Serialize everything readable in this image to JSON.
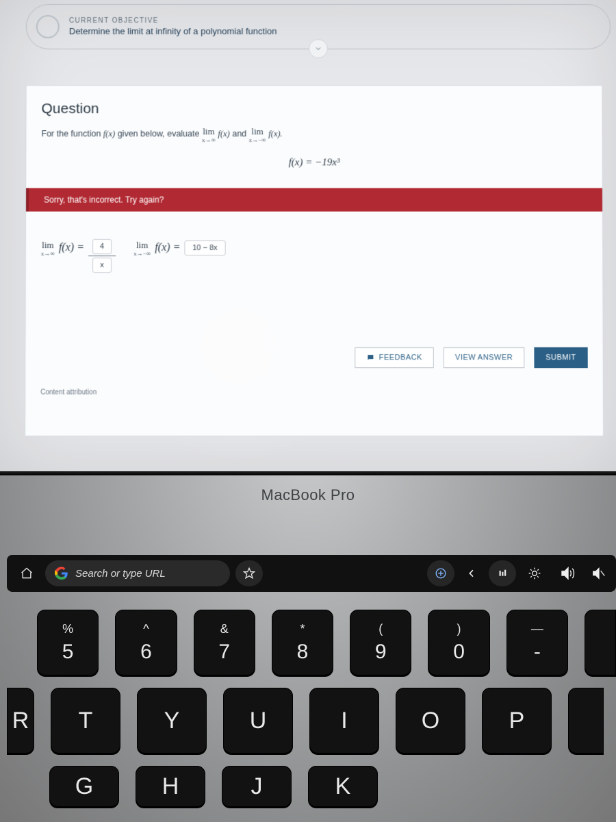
{
  "header": {
    "kicker": "CURRENT OBJECTIVE",
    "title": "Determine the limit at infinity of a polynomial function"
  },
  "question": {
    "heading": "Question",
    "prompt_prefix": "For the function ",
    "prompt_fn": "f(x)",
    "prompt_mid": " given below, evaluate ",
    "lim1_top": "lim",
    "lim1_bot": "x→∞",
    "lim1_fn": "f(x)",
    "and": " and ",
    "lim2_top": "lim",
    "lim2_bot": "x→−∞",
    "lim2_fn": "f(x).",
    "formula": "f(x) = −19x³"
  },
  "banner": "Sorry, that's incorrect. Try again?",
  "answers": {
    "a1_lim_top": "lim",
    "a1_lim_bot": "x→∞",
    "a1_fx": "f(x) =",
    "a1_chip_num": "4",
    "a1_chip_den": "x",
    "a2_lim_top": "lim",
    "a2_lim_bot": "x→−∞",
    "a2_fx": "f(x) =",
    "a2_chip": "10 − 8x"
  },
  "actions": {
    "feedback": "FEEDBACK",
    "view": "VIEW ANSWER",
    "submit": "SUBMIT"
  },
  "attrib": "Content attribution",
  "laptop_label": "MacBook Pro",
  "touchbar": {
    "search_placeholder": "Search or type URL"
  },
  "keys": {
    "r1": [
      {
        "u": "%",
        "l": "5"
      },
      {
        "u": "^",
        "l": "6"
      },
      {
        "u": "&",
        "l": "7"
      },
      {
        "u": "*",
        "l": "8"
      },
      {
        "u": "(",
        "l": "9"
      },
      {
        "u": ")",
        "l": "0"
      },
      {
        "u": "—",
        "l": "-"
      }
    ],
    "r2": [
      "T",
      "Y",
      "U",
      "I",
      "O",
      "P"
    ],
    "r2_left": "R",
    "r3": [
      "G",
      "H",
      "J",
      "K"
    ]
  }
}
